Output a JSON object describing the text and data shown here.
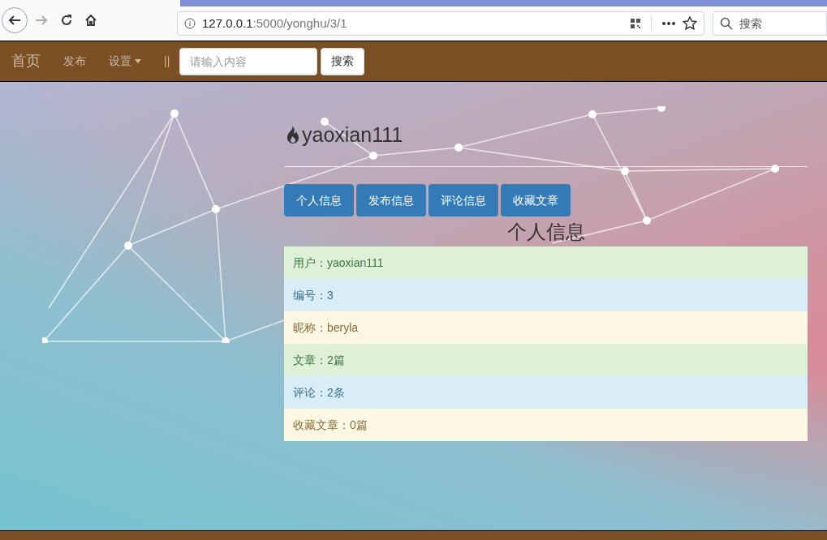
{
  "browser": {
    "url_host": "127.0.0.1",
    "url_path": ":5000/yonghu/3/1",
    "search_placeholder": "搜索"
  },
  "navbar": {
    "brand": "首页",
    "links": [
      {
        "label": "发布",
        "kind": "link"
      },
      {
        "label": "设置",
        "kind": "dropdown"
      },
      {
        "label": "||",
        "kind": "text"
      }
    ],
    "search_placeholder": "请输入内容",
    "search_button": "搜索"
  },
  "profile": {
    "username": "yaoxian111"
  },
  "tabs": [
    {
      "label": "个人信息"
    },
    {
      "label": "发布信息"
    },
    {
      "label": "评论信息"
    },
    {
      "label": "收藏文章"
    }
  ],
  "section_title": "个人信息",
  "rows": [
    {
      "text": "用户：yaoxian111",
      "kind": "success"
    },
    {
      "text": "编号：3",
      "kind": "info"
    },
    {
      "text": "昵称：beryla",
      "kind": "warning"
    },
    {
      "text": "文章：2篇",
      "kind": "success"
    },
    {
      "text": "评论：2条",
      "kind": "info"
    },
    {
      "text": "收藏文章：0篇",
      "kind": "warning"
    }
  ]
}
